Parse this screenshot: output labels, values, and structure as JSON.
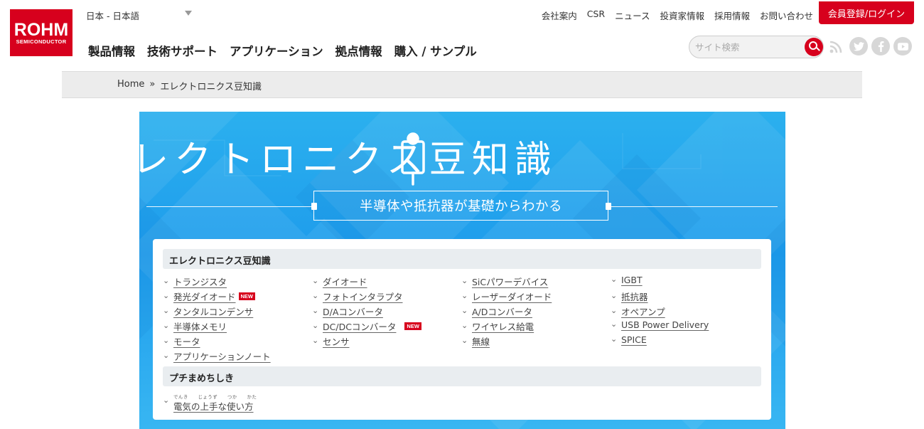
{
  "brand": {
    "logo_main": "ROHM",
    "logo_sub": "SEMICONDUCTOR",
    "color": "#d7001d"
  },
  "header": {
    "language": "日本 - 日本語",
    "top_links": [
      "会社案内",
      "CSR",
      "ニュース",
      "投資家情報",
      "採用情報",
      "お問い合わせ"
    ],
    "login_label": "会員登録/ログイン",
    "main_nav": [
      "製品情報",
      "技術サポート",
      "アプリケーション",
      "拠点情報",
      "購入 / サンプル"
    ],
    "search_placeholder": "サイト検索",
    "social": [
      "rss-icon",
      "twitter-icon",
      "facebook-icon",
      "youtube-icon"
    ]
  },
  "breadcrumb": {
    "home": "Home",
    "separator": "»",
    "current": "エレクトロニクス豆知識"
  },
  "hero": {
    "title": "エレクトロニクス豆知識",
    "subtitle": "半導体や抵抗器が基礎からわかる"
  },
  "sections": {
    "main_heading": "エレクトロニクス豆知識",
    "new_badge": "NEW",
    "columns": [
      [
        {
          "label": "トランジスタ",
          "new": false
        },
        {
          "label": "発光ダイオード",
          "new": true
        },
        {
          "label": "タンタルコンデンサ",
          "new": false
        },
        {
          "label": "半導体メモリ",
          "new": false
        },
        {
          "label": "モータ",
          "new": false
        },
        {
          "label": "アプリケーションノート",
          "new": false
        }
      ],
      [
        {
          "label": "ダイオード",
          "new": false
        },
        {
          "label": "フォトインタラプタ",
          "new": false
        },
        {
          "label": "D/Aコンバータ",
          "new": false
        },
        {
          "label": "DC/DCコンバータ",
          "new": true
        },
        {
          "label": "センサ",
          "new": false
        }
      ],
      [
        {
          "label": "SiCパワーデバイス",
          "new": false
        },
        {
          "label": "レーザーダイオード",
          "new": false
        },
        {
          "label": "A/Dコンバータ",
          "new": false
        },
        {
          "label": "ワイヤレス給電",
          "new": false
        },
        {
          "label": "無線",
          "new": false
        }
      ],
      [
        {
          "label": "IGBT",
          "new": false
        },
        {
          "label": "抵抗器",
          "new": false
        },
        {
          "label": "オペアンプ",
          "new": false
        },
        {
          "label": "USB Power Delivery",
          "new": false
        },
        {
          "label": "SPICE",
          "new": false
        }
      ]
    ],
    "sub_heading": "プチまめちしき",
    "sub_link": "電気の上手な使い方",
    "sub_link_ruby": "でんき　　じょうず　　つか　　かた"
  }
}
